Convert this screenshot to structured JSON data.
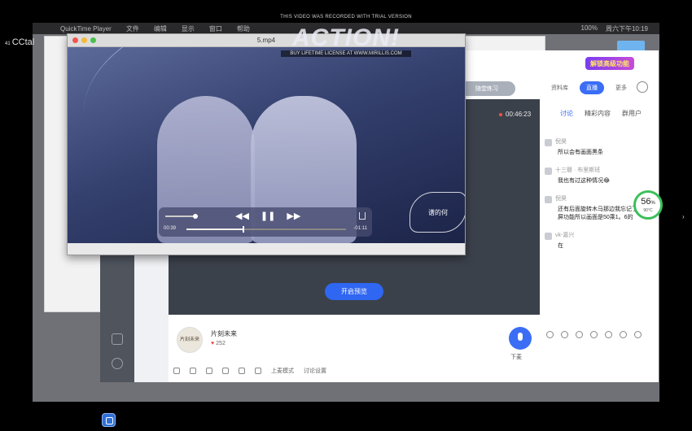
{
  "watermark": {
    "top": "THIS VIDEO WAS RECORDED WITH TRIAL VERSION",
    "logo": "ACTION!",
    "bottom": "BUY LIFETIME LICENSE AT WWW.MIRILLIS.COM"
  },
  "menubar": {
    "app": "QuickTime Player",
    "items": [
      "文件",
      "编辑",
      "显示",
      "窗口",
      "帮助"
    ],
    "battery": "100%",
    "clock": "周六下午10:19"
  },
  "left_tag": {
    "prefix": "41",
    "text": "CCtal"
  },
  "player": {
    "title": "5.mp4",
    "elapsed": "00:39",
    "remaining": "-01:11",
    "progress": 0.35,
    "volume": 0.85,
    "signature_text": "谱的何"
  },
  "app": {
    "promo": "解锁高级功能",
    "practice_pill": "随堂练习",
    "tabs": [
      "资料库",
      "直播",
      "更多"
    ],
    "active_tab": 1,
    "timer": "00:46:23",
    "start_button": "开启预览",
    "chat_tabs": [
      "讨论",
      "精彩内容",
      "群用户"
    ],
    "messages": [
      {
        "user": "倪昊",
        "text": "所以会有画面黑条"
      },
      {
        "user": "十三磬 · 布里斯班",
        "text": "我也有过这种情况😂"
      },
      {
        "user": "倪昊",
        "text": "还有后面旋转木马那边我忘记了关闭截屏功能所以画面是50乘1。6的"
      },
      {
        "user": "vk-嘉兴",
        "text": "在"
      }
    ],
    "host": {
      "avatar_text": "片刻未来",
      "name": "片刻未来",
      "likes": "252"
    },
    "mic_label": "下麦",
    "tools": [
      "上麦模式",
      "讨论设置"
    ]
  },
  "gauge": {
    "percent": "56",
    "unit": "%",
    "temp": "90°C"
  }
}
